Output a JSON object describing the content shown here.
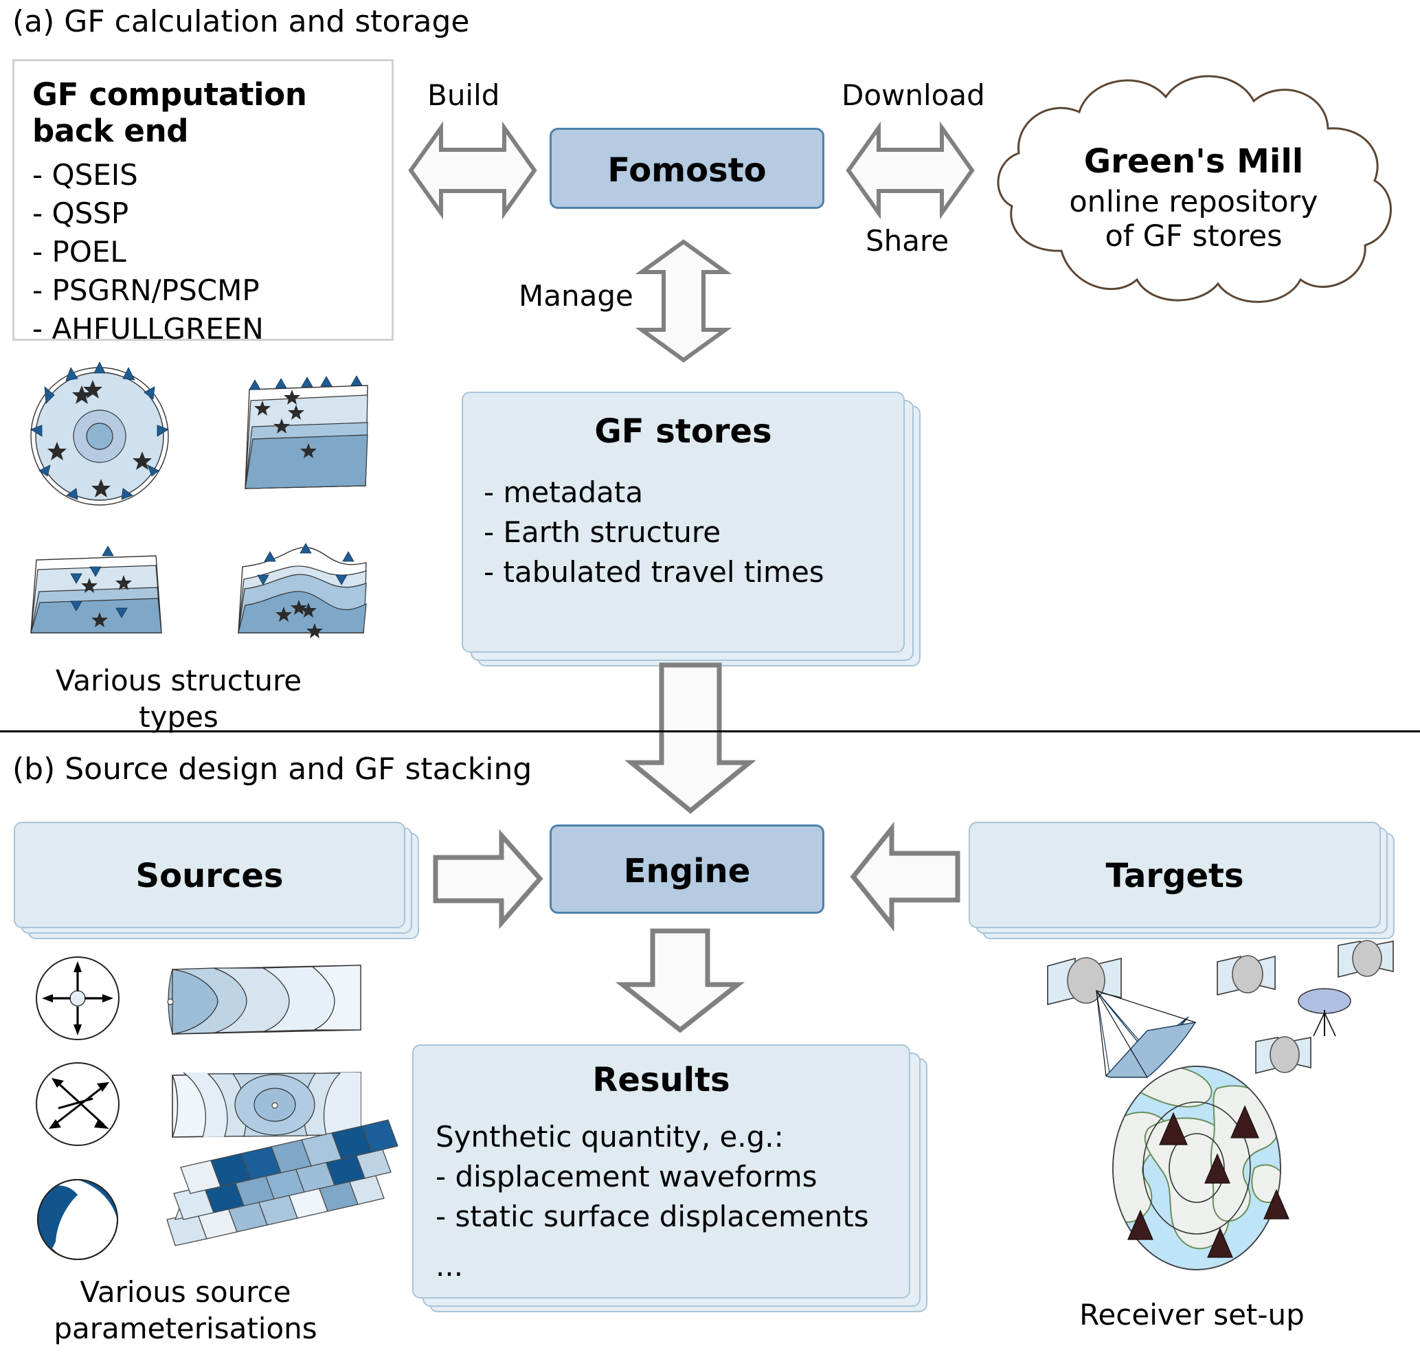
{
  "figure": {
    "panel_a": {
      "heading": "(a) GF calculation and storage",
      "backend": {
        "title_line1": "GF computation",
        "title_line2": "back end",
        "items": [
          "- QSEIS",
          "- QSSP",
          "- POEL",
          "- PSGRN/PSCMP",
          "- AHFULLGREEN"
        ]
      },
      "fomosto": {
        "label": "Fomosto"
      },
      "cloud": {
        "title": "Green's Mill",
        "line1": "online repository",
        "line2": "of GF stores"
      },
      "arrows": {
        "build": "Build",
        "download": "Download",
        "share": "Share",
        "manage": "Manage"
      },
      "gf_stores": {
        "title": "GF stores",
        "items": [
          "- metadata",
          "- Earth structure",
          "- tabulated travel times"
        ]
      },
      "structures_caption_line1": "Various structure",
      "structures_caption_line2": "types"
    },
    "panel_b": {
      "heading": "(b) Source design and GF stacking",
      "sources": {
        "label": "Sources"
      },
      "engine": {
        "label": "Engine"
      },
      "targets": {
        "label": "Targets"
      },
      "results": {
        "title": "Results",
        "line1": "Synthetic quantity, e.g.:",
        "line2": "- displacement waveforms",
        "line3": "- static surface displacements",
        "line4": "..."
      },
      "sources_caption_line1": "Various source",
      "sources_caption_line2": "parameterisations",
      "receiver_caption": "Receiver set-up"
    }
  },
  "colors": {
    "primary_box_fill": "#b4cbe1",
    "primary_box_border": "#4e81ac",
    "light_box_fill": "#dfeaf1",
    "light_box_border": "#a9c4d8",
    "arrow_fill": "#fafafa",
    "arrow_border": "#808080",
    "cloud_border": "#5c4634",
    "structure_dark": "#7fa8c8",
    "structure_mid": "#a8c6dd",
    "structure_light": "#d5e4ef",
    "marker_blue": "#1f5c94",
    "beachball_blue": "#12558c",
    "text": "#000000"
  }
}
